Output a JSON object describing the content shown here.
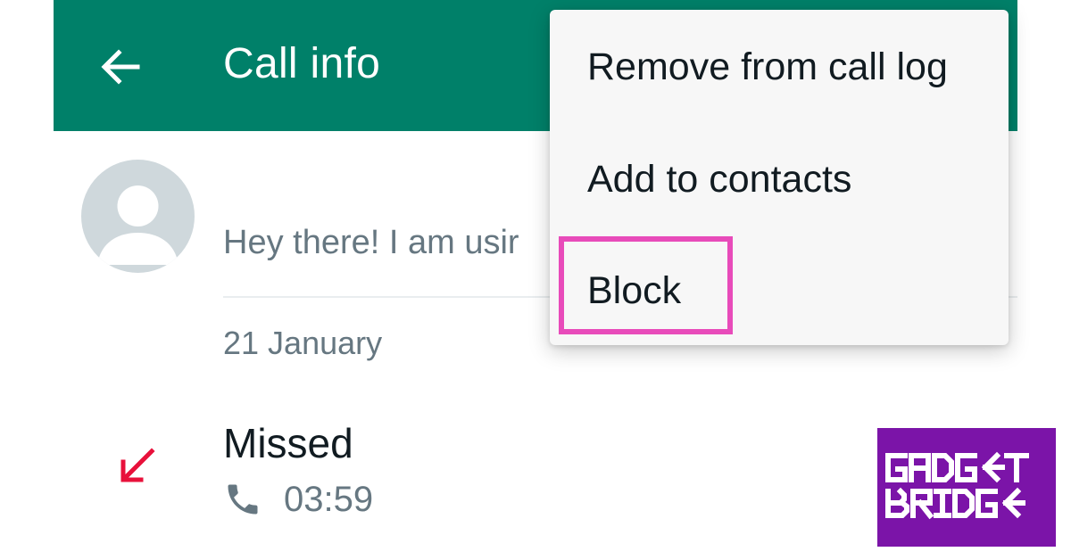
{
  "app_bar": {
    "title": "Call info",
    "back_icon": "arrow-left-icon",
    "background": "#008069"
  },
  "contact": {
    "name": "",
    "status": "Hey there! I am usir",
    "avatar_icon": "default-avatar-icon"
  },
  "call_log": {
    "date": "21 January",
    "calls": [
      {
        "type": "Missed",
        "time": "03:59",
        "direction_icon": "missed-call-arrow-icon",
        "direction_color": "#e8113b",
        "call_icon": "phone-icon"
      }
    ]
  },
  "overflow_menu": {
    "items": [
      {
        "label": "Remove from call log"
      },
      {
        "label": "Add to contacts"
      },
      {
        "label": "Block"
      }
    ],
    "highlighted_item": "Block",
    "highlight_color": "#e84bba"
  },
  "watermark": {
    "line1": "GADGET",
    "line2": "BRIDGE",
    "background": "#7b14a8"
  }
}
